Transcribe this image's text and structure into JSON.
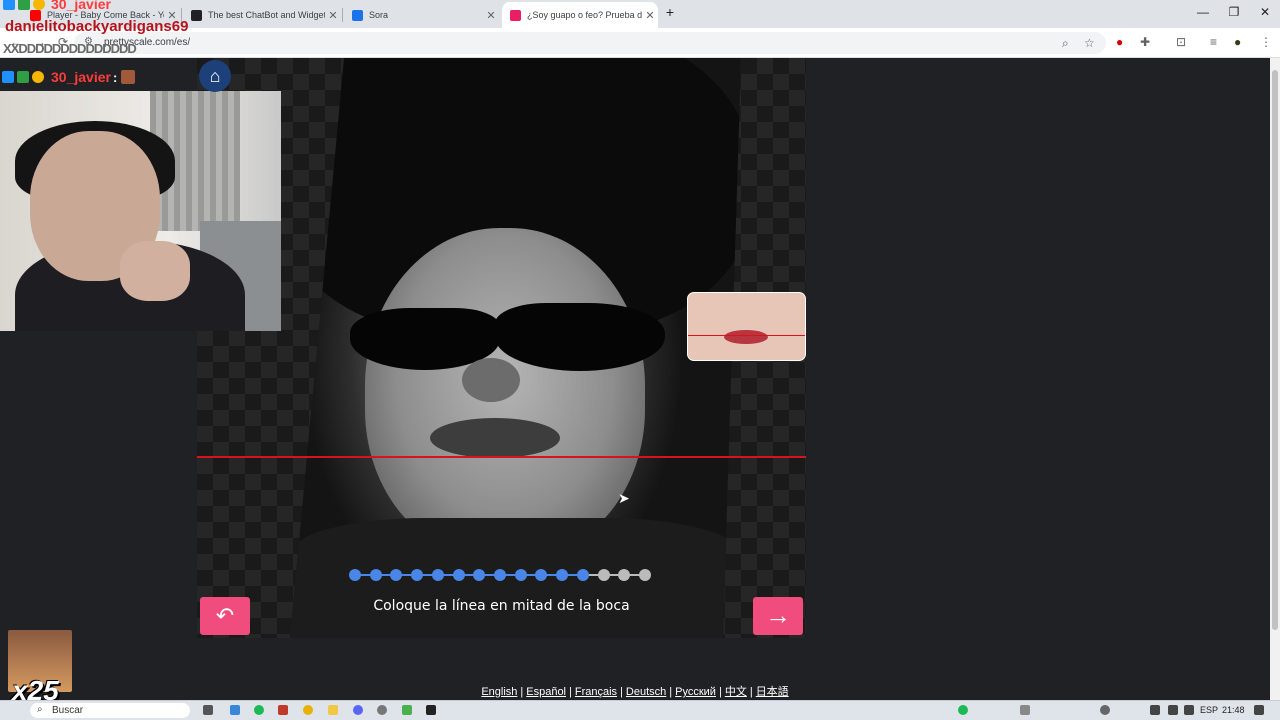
{
  "browser": {
    "tabs": [
      {
        "title": "Player - Baby Come Back - You",
        "favicon_color": "#ff0000",
        "active": false
      },
      {
        "title": "The best ChatBot and Widgets",
        "favicon_color": "#202124",
        "active": false
      },
      {
        "title": "Sora",
        "favicon_color": "#1a73e8",
        "active": false
      },
      {
        "title": "¿Soy guapo o feo? Prueba de a",
        "favicon_color": "#e91e63",
        "active": true
      }
    ],
    "new_tab": "+",
    "url": "prettyscale.com/es/"
  },
  "app": {
    "home_icon": "home-icon",
    "instruction": "Coloque la línea en mitad de la boca",
    "progress": {
      "total": 15,
      "completed": 12,
      "done_color": "#4a86e8",
      "pending_color": "#bbbbbb"
    },
    "guide_line_color": "#d9121c",
    "accent_color": "#f04c7d",
    "back_icon": "↶",
    "next_icon": "→"
  },
  "languages": [
    "English",
    "Español",
    "Français",
    "Deutsch",
    "Русский",
    "中文",
    "日本語"
  ],
  "language_separator": "|",
  "overlay": {
    "top_username": "30_javier",
    "viewer_name": "danielitobackyardigans69",
    "chat_spam": "XXDDDDDDDDDDDDDD",
    "username": "30_javier",
    "combo": "x25"
  },
  "taskbar": {
    "search_placeholder": "Buscar",
    "lang": "ESP",
    "time": "21:48"
  }
}
